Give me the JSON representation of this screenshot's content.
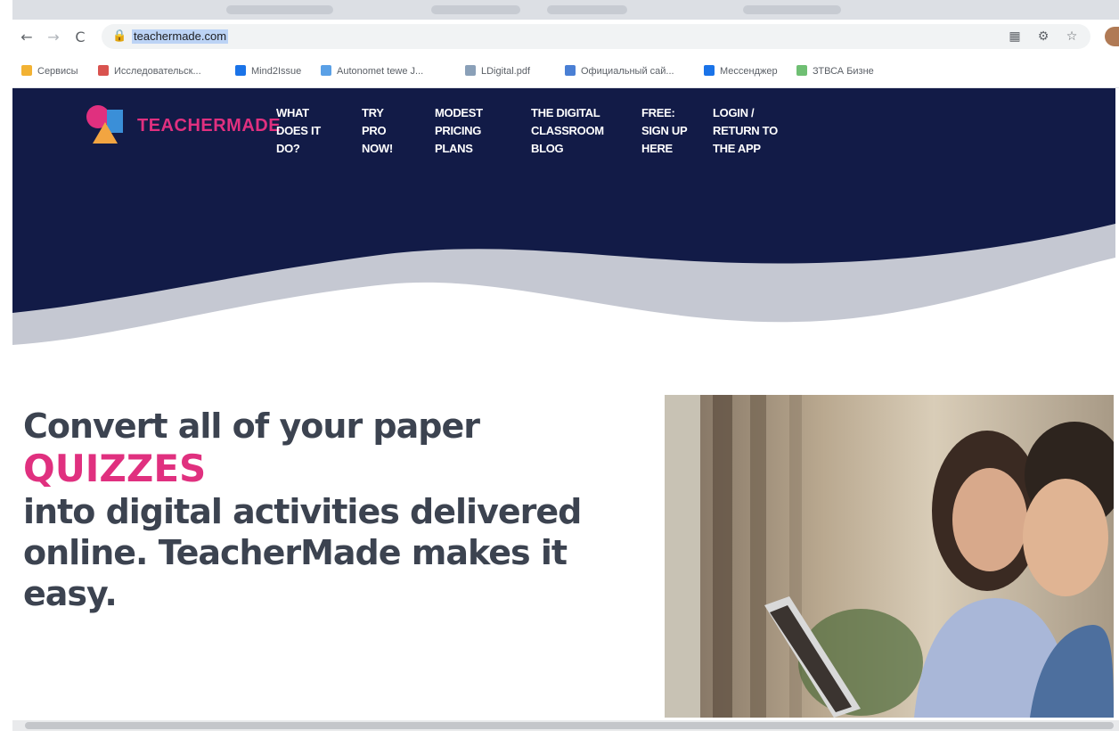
{
  "browser": {
    "url": "teachermade.com",
    "nav": {
      "back": "←",
      "forward": "→",
      "reload": "C"
    },
    "lock_icon": "lock-icon",
    "bookmarks": [
      {
        "label": "Сервисы",
        "color": "#f2b233"
      },
      {
        "label": "Исследовательск...",
        "color": "#d9534f"
      },
      {
        "label": "Mind2Issue",
        "color": "#1a73e8"
      },
      {
        "label": "Autonomet tewe J...",
        "color": "#5aa0e6"
      },
      {
        "label": "LDigital.pdf",
        "color": "#8aa0b8"
      },
      {
        "label": "Официальный сай...",
        "color": "#4a7fd4"
      },
      {
        "label": "Мессенджер",
        "color": "#1a73e8"
      },
      {
        "label": "ЗТВСА Бизне",
        "color": "#6fbf73"
      }
    ]
  },
  "site": {
    "logo_text": "TEACHERMADE",
    "nav": [
      {
        "label": "WHAT\nDOES IT\nDO?"
      },
      {
        "label": "TRY\nPRO\nNOW!"
      },
      {
        "label": "MODEST\nPRICING\nPLANS"
      },
      {
        "label": "THE DIGITAL\nCLASSROOM\nBLOG"
      },
      {
        "label": "FREE:\nSIGN UP\nHERE"
      },
      {
        "label": "LOGIN /\nRETURN TO\nTHE APP"
      }
    ],
    "colors": {
      "navy": "#121b47",
      "pink": "#e0307f",
      "gray_wave": "#c5c8d2"
    }
  },
  "hero": {
    "line1": "Convert all of your paper",
    "accent": "QUIZZES",
    "rest_line1": "into digital activities delivered",
    "rest_line2": "online. TeacherMade makes it",
    "rest_line3": "easy."
  }
}
